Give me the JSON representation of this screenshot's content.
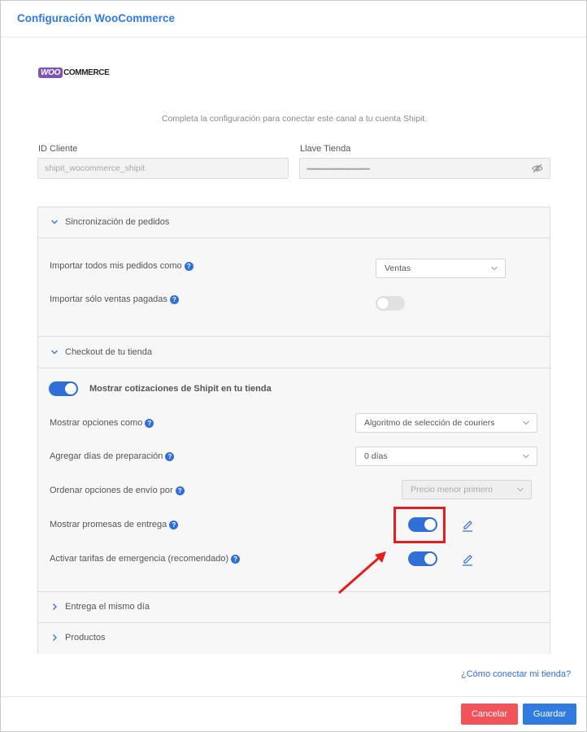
{
  "modal": {
    "title": "Configuración WooCommerce"
  },
  "logo": {
    "woo": "WOO",
    "commerce": "COMMERCE"
  },
  "subtitle": "Completa la configuración para conectar este canal a tu cuenta Shipit.",
  "credentials": {
    "client_id_label": "ID Cliente",
    "client_id_value": "shipit_wocommerce_shipit",
    "store_key_label": "Llave Tienda",
    "store_key_value": "••••••••••••••••••••••••••••••••••••"
  },
  "sync": {
    "title": "Sincronización de pedidos",
    "import_label": "Importar todos mis pedidos como",
    "import_value": "Ventas",
    "paid_only_label": "Importar sólo ventas pagadas"
  },
  "checkout": {
    "title": "Checkout de tu tienda",
    "show_quotes_label": "Mostrar cotizaciones de Shipit en tu tienda",
    "show_options_label": "Mostrar opciones como",
    "show_options_value": "Algoritmo de selección de couriers",
    "prep_days_label": "Agregar días de preparación",
    "prep_days_value": "0 días",
    "sort_label": "Ordenar opciones de envío por",
    "sort_value": "Precio menor primero",
    "promises_label": "Mostrar promesas de entrega",
    "emergency_label": "Activar tarifas de emergencia (recomendado)"
  },
  "same_day": {
    "title": "Entrega el mismo día"
  },
  "products": {
    "title": "Productos"
  },
  "help_link": "¿Cómo conectar mi tienda?",
  "buttons": {
    "cancel": "Cancelar",
    "save": "Guardar"
  },
  "help_glyph": "?",
  "colors": {
    "accent": "#2f6fd6",
    "title": "#2f7be0",
    "cancel": "#f2535a",
    "annotation": "#e41e1e",
    "woo_brand": "#7f54b3"
  },
  "toggles": {
    "paid_only": false,
    "show_quotes": true,
    "promises": true,
    "emergency": true
  }
}
